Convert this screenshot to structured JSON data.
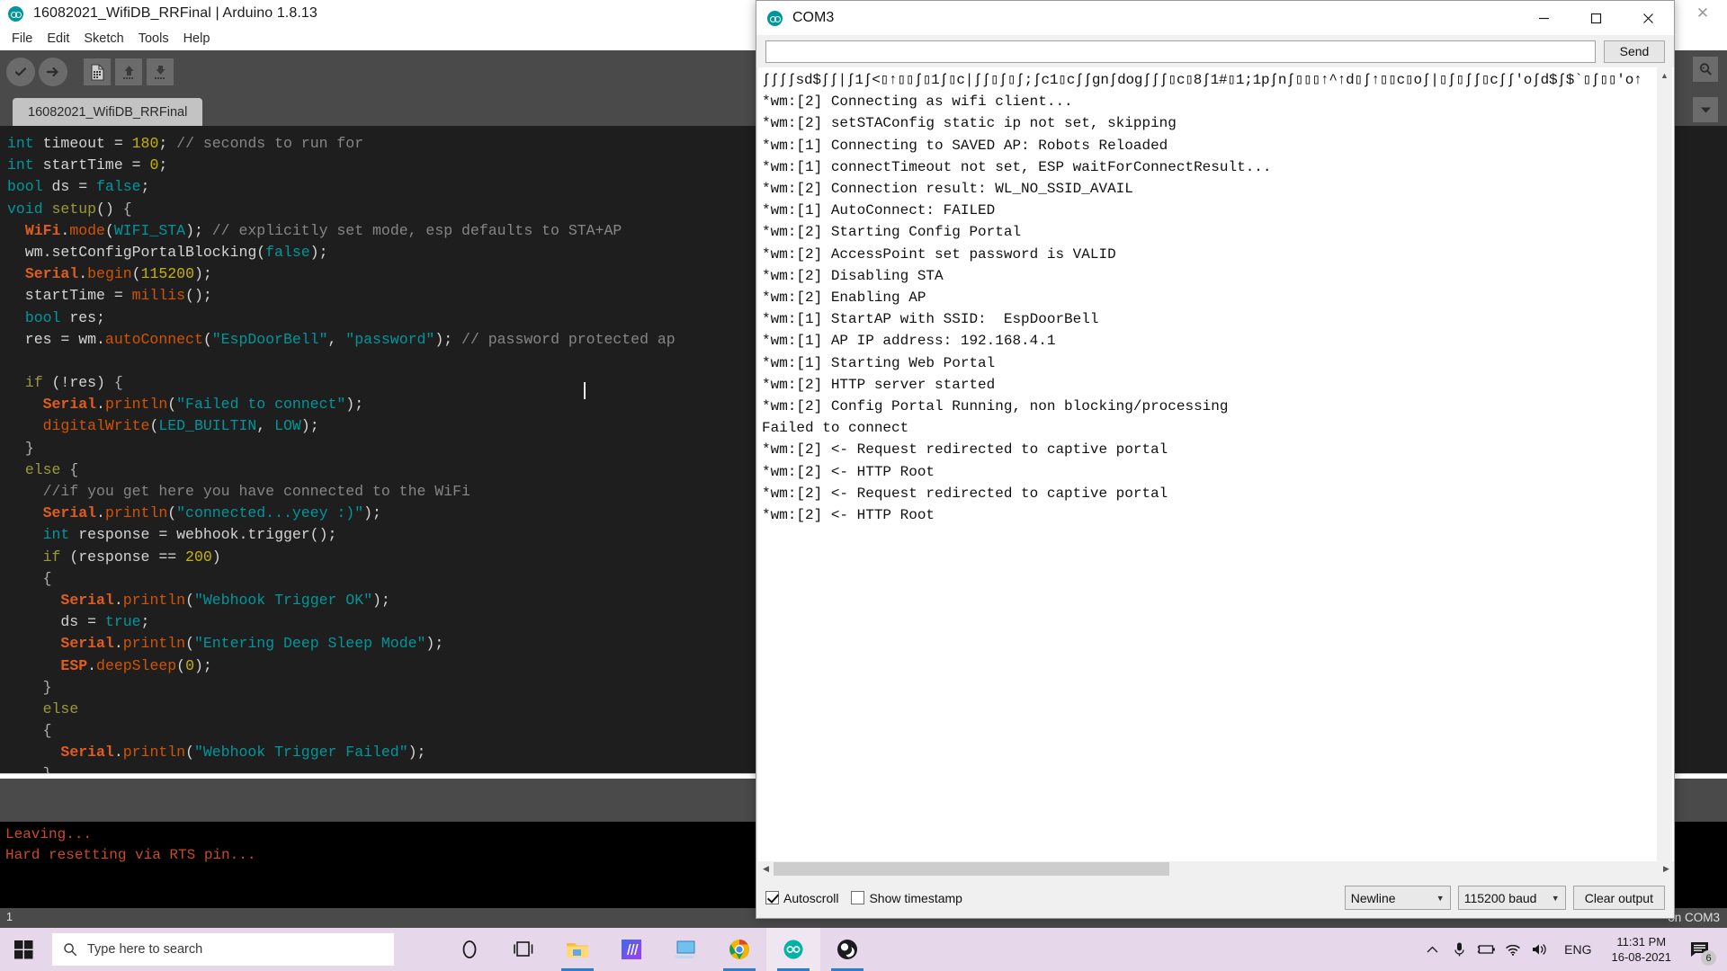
{
  "arduino": {
    "title": "16082021_WifiDB_RRFinal | Arduino 1.8.13",
    "logo_icon": "arduino-logo-icon",
    "close_icon": "close-icon",
    "menu": [
      {
        "label": "File"
      },
      {
        "label": "Edit"
      },
      {
        "label": "Sketch"
      },
      {
        "label": "Tools"
      },
      {
        "label": "Help"
      }
    ],
    "toolbar": [
      {
        "name": "verify-button",
        "icon": "checkmark-icon"
      },
      {
        "name": "upload-button",
        "icon": "arrow-right-icon"
      },
      {
        "name": "new-sketch-button",
        "icon": "new-file-icon"
      },
      {
        "name": "open-button",
        "icon": "arrow-up-icon"
      },
      {
        "name": "save-button",
        "icon": "arrow-down-icon"
      },
      {
        "name": "serial-monitor-button",
        "icon": "magnifier-icon"
      },
      {
        "name": "tab-menu-button",
        "icon": "chevron-down-icon"
      }
    ],
    "tab_label": "16082021_WifiDB_RRFinal",
    "code_lines": [
      [
        {
          "t": "int",
          "c": "k"
        },
        {
          "t": " timeout = ",
          "c": "pl"
        },
        {
          "t": "180",
          "c": "num"
        },
        {
          "t": "; ",
          "c": "pl"
        },
        {
          "t": "// seconds to run for",
          "c": "cm"
        }
      ],
      [
        {
          "t": "int",
          "c": "k"
        },
        {
          "t": " startTime = ",
          "c": "pl"
        },
        {
          "t": "0",
          "c": "num"
        },
        {
          "t": ";",
          "c": "pl"
        }
      ],
      [
        {
          "t": "bool",
          "c": "k"
        },
        {
          "t": " ds = ",
          "c": "pl"
        },
        {
          "t": "false",
          "c": "str"
        },
        {
          "t": ";",
          "c": "pl"
        }
      ],
      [
        {
          "t": "void",
          "c": "k"
        },
        {
          "t": " ",
          "c": "pl"
        },
        {
          "t": "setup",
          "c": "ctl"
        },
        {
          "t": "() ",
          "c": "pl"
        },
        {
          "t": "{",
          "c": "br"
        }
      ],
      [
        {
          "t": "  ",
          "c": "pl"
        },
        {
          "t": "WiFi",
          "c": "lib"
        },
        {
          "t": ".",
          "c": "pl"
        },
        {
          "t": "mode",
          "c": "fn"
        },
        {
          "t": "(",
          "c": "pl"
        },
        {
          "t": "WIFI_STA",
          "c": "str"
        },
        {
          "t": "); ",
          "c": "pl"
        },
        {
          "t": "// explicitly set mode, esp defaults to STA+AP",
          "c": "cm"
        }
      ],
      [
        {
          "t": "  wm.setConfigPortalBlocking(",
          "c": "pl"
        },
        {
          "t": "false",
          "c": "str"
        },
        {
          "t": ");",
          "c": "pl"
        }
      ],
      [
        {
          "t": "  ",
          "c": "pl"
        },
        {
          "t": "Serial",
          "c": "lib"
        },
        {
          "t": ".",
          "c": "pl"
        },
        {
          "t": "begin",
          "c": "fn"
        },
        {
          "t": "(",
          "c": "pl"
        },
        {
          "t": "115200",
          "c": "num"
        },
        {
          "t": ");",
          "c": "pl"
        }
      ],
      [
        {
          "t": "  startTime = ",
          "c": "pl"
        },
        {
          "t": "millis",
          "c": "fn"
        },
        {
          "t": "();",
          "c": "pl"
        }
      ],
      [
        {
          "t": "  ",
          "c": "pl"
        },
        {
          "t": "bool",
          "c": "k"
        },
        {
          "t": " res;",
          "c": "pl"
        }
      ],
      [
        {
          "t": "  res = wm.",
          "c": "pl"
        },
        {
          "t": "autoConnect",
          "c": "fn"
        },
        {
          "t": "(",
          "c": "pl"
        },
        {
          "t": "\"EspDoorBell\"",
          "c": "str"
        },
        {
          "t": ", ",
          "c": "pl"
        },
        {
          "t": "\"password\"",
          "c": "str"
        },
        {
          "t": "); ",
          "c": "pl"
        },
        {
          "t": "// password protected ap",
          "c": "cm"
        }
      ],
      [
        {
          "t": "",
          "c": "pl"
        }
      ],
      [
        {
          "t": "  ",
          "c": "pl"
        },
        {
          "t": "if",
          "c": "ctl"
        },
        {
          "t": " (!res) ",
          "c": "pl"
        },
        {
          "t": "{",
          "c": "br"
        }
      ],
      [
        {
          "t": "    ",
          "c": "pl"
        },
        {
          "t": "Serial",
          "c": "lib"
        },
        {
          "t": ".",
          "c": "pl"
        },
        {
          "t": "println",
          "c": "fn"
        },
        {
          "t": "(",
          "c": "pl"
        },
        {
          "t": "\"Failed to connect\"",
          "c": "str"
        },
        {
          "t": ");",
          "c": "pl"
        }
      ],
      [
        {
          "t": "    ",
          "c": "pl"
        },
        {
          "t": "digitalWrite",
          "c": "fn"
        },
        {
          "t": "(",
          "c": "pl"
        },
        {
          "t": "LED_BUILTIN",
          "c": "str"
        },
        {
          "t": ", ",
          "c": "pl"
        },
        {
          "t": "LOW",
          "c": "str"
        },
        {
          "t": ");",
          "c": "pl"
        }
      ],
      [
        {
          "t": "  ",
          "c": "pl"
        },
        {
          "t": "}",
          "c": "br"
        }
      ],
      [
        {
          "t": "  ",
          "c": "pl"
        },
        {
          "t": "else",
          "c": "ctl"
        },
        {
          "t": " ",
          "c": "pl"
        },
        {
          "t": "{",
          "c": "br"
        }
      ],
      [
        {
          "t": "    ",
          "c": "pl"
        },
        {
          "t": "//if you get here you have connected to the WiFi",
          "c": "cm"
        }
      ],
      [
        {
          "t": "    ",
          "c": "pl"
        },
        {
          "t": "Serial",
          "c": "lib"
        },
        {
          "t": ".",
          "c": "pl"
        },
        {
          "t": "println",
          "c": "fn"
        },
        {
          "t": "(",
          "c": "pl"
        },
        {
          "t": "\"connected...yeey :)\"",
          "c": "str"
        },
        {
          "t": ");",
          "c": "pl"
        }
      ],
      [
        {
          "t": "    ",
          "c": "pl"
        },
        {
          "t": "int",
          "c": "k"
        },
        {
          "t": " response = webhook.trigger();",
          "c": "pl"
        }
      ],
      [
        {
          "t": "    ",
          "c": "pl"
        },
        {
          "t": "if",
          "c": "ctl"
        },
        {
          "t": " (response == ",
          "c": "pl"
        },
        {
          "t": "200",
          "c": "num"
        },
        {
          "t": ")",
          "c": "pl"
        }
      ],
      [
        {
          "t": "    ",
          "c": "pl"
        },
        {
          "t": "{",
          "c": "br"
        }
      ],
      [
        {
          "t": "      ",
          "c": "pl"
        },
        {
          "t": "Serial",
          "c": "lib"
        },
        {
          "t": ".",
          "c": "pl"
        },
        {
          "t": "println",
          "c": "fn"
        },
        {
          "t": "(",
          "c": "pl"
        },
        {
          "t": "\"Webhook Trigger OK\"",
          "c": "str"
        },
        {
          "t": ");",
          "c": "pl"
        }
      ],
      [
        {
          "t": "      ds = ",
          "c": "pl"
        },
        {
          "t": "true",
          "c": "str"
        },
        {
          "t": ";",
          "c": "pl"
        }
      ],
      [
        {
          "t": "      ",
          "c": "pl"
        },
        {
          "t": "Serial",
          "c": "lib"
        },
        {
          "t": ".",
          "c": "pl"
        },
        {
          "t": "println",
          "c": "fn"
        },
        {
          "t": "(",
          "c": "pl"
        },
        {
          "t": "\"Entering Deep Sleep Mode\"",
          "c": "str"
        },
        {
          "t": ");",
          "c": "pl"
        }
      ],
      [
        {
          "t": "      ",
          "c": "pl"
        },
        {
          "t": "ESP",
          "c": "lib"
        },
        {
          "t": ".",
          "c": "pl"
        },
        {
          "t": "deepSleep",
          "c": "fn"
        },
        {
          "t": "(",
          "c": "pl"
        },
        {
          "t": "0",
          "c": "num"
        },
        {
          "t": ");",
          "c": "pl"
        }
      ],
      [
        {
          "t": "    ",
          "c": "pl"
        },
        {
          "t": "}",
          "c": "br"
        }
      ],
      [
        {
          "t": "    ",
          "c": "pl"
        },
        {
          "t": "else",
          "c": "ctl"
        }
      ],
      [
        {
          "t": "    ",
          "c": "pl"
        },
        {
          "t": "{",
          "c": "br"
        }
      ],
      [
        {
          "t": "      ",
          "c": "pl"
        },
        {
          "t": "Serial",
          "c": "lib"
        },
        {
          "t": ".",
          "c": "pl"
        },
        {
          "t": "println",
          "c": "fn"
        },
        {
          "t": "(",
          "c": "pl"
        },
        {
          "t": "\"Webhook Trigger Failed\"",
          "c": "str"
        },
        {
          "t": ");",
          "c": "pl"
        }
      ],
      [
        {
          "t": "    ",
          "c": "pl"
        },
        {
          "t": "}",
          "c": "br"
        }
      ]
    ],
    "console_lines": [
      "Leaving...",
      "Hard resetting via RTS pin..."
    ],
    "status_left": "1",
    "status_right": "on COM3"
  },
  "serial_monitor": {
    "title": "COM3",
    "logo_icon": "arduino-logo-icon",
    "input_value": "",
    "input_placeholder": "",
    "send_label": "Send",
    "minimize_icon": "minimize-icon",
    "maximize_icon": "maximize-icon",
    "close_icon": "close-icon",
    "output_lines": [
      "ʃʃʃʃsd$ʃʃ|ʃ1ʃ<▯↑▯▯ʃ▯1ʃ▯c|ʃʃ▯ʃ▯ʃ;ʃc1▯cʃʃgnʃdogʃʃʃ▯c▯8ʃ1#▯1;1pʃnʃ▯▯▯↑^↑d▯ʃ↑▯▯c▯oʃ|▯ʃ▯ʃʃ▯cʃʃ'oʃd$ʃ$`▯ʃ▯▯'o↑",
      "*wm:[2] Connecting as wifi client...",
      "*wm:[2] setSTAConfig static ip not set, skipping",
      "*wm:[1] Connecting to SAVED AP: Robots Reloaded",
      "*wm:[1] connectTimeout not set, ESP waitForConnectResult...",
      "*wm:[2] Connection result: WL_NO_SSID_AVAIL",
      "*wm:[1] AutoConnect: FAILED",
      "*wm:[2] Starting Config Portal",
      "*wm:[2] AccessPoint set password is VALID",
      "*wm:[2] Disabling STA",
      "*wm:[2] Enabling AP",
      "*wm:[1] StartAP with SSID:  EspDoorBell",
      "*wm:[1] AP IP address: 192.168.4.1",
      "*wm:[1] Starting Web Portal",
      "*wm:[2] HTTP server started",
      "*wm:[2] Config Portal Running, non blocking/processing",
      "Failed to connect",
      "*wm:[2] <- Request redirected to captive portal",
      "*wm:[2] <- HTTP Root",
      "*wm:[2] <- Request redirected to captive portal",
      "*wm:[2] <- HTTP Root"
    ],
    "autoscroll_label": "Autoscroll",
    "autoscroll_checked": true,
    "timestamp_label": "Show timestamp",
    "timestamp_checked": false,
    "line_ending": "Newline",
    "baud_rate": "115200 baud",
    "clear_label": "Clear output"
  },
  "taskbar": {
    "start_icon": "windows-start-icon",
    "search_icon": "search-icon",
    "search_placeholder": "Type here to search",
    "apps": [
      {
        "name": "cortana-icon",
        "running": false,
        "active": false
      },
      {
        "name": "task-view-icon",
        "running": false,
        "active": false
      },
      {
        "name": "file-explorer-icon",
        "running": true,
        "active": false
      },
      {
        "name": "app-icon",
        "running": false,
        "active": false
      },
      {
        "name": "remote-desktop-icon",
        "running": false,
        "active": false
      },
      {
        "name": "chrome-icon",
        "running": true,
        "active": false
      },
      {
        "name": "arduino-icon",
        "running": true,
        "active": true
      },
      {
        "name": "obs-icon",
        "running": true,
        "active": false
      }
    ],
    "tray": {
      "chevron_icon": "chevron-up-icon",
      "mic_icon": "microphone-icon",
      "battery_icon": "battery-icon",
      "wifi_icon": "wifi-icon",
      "volume_icon": "volume-icon",
      "language": "ENG",
      "time": "11:31 PM",
      "date": "16-08-2021",
      "notification_icon": "notification-icon",
      "notification_count": "6"
    }
  },
  "colors": {
    "arduino_teal": "#00979c",
    "toolbar_gray": "#4a4a4a",
    "editor_bg": "#1e1e1e",
    "console_text": "#cc4a28",
    "taskbar": "#e6d7ea"
  }
}
